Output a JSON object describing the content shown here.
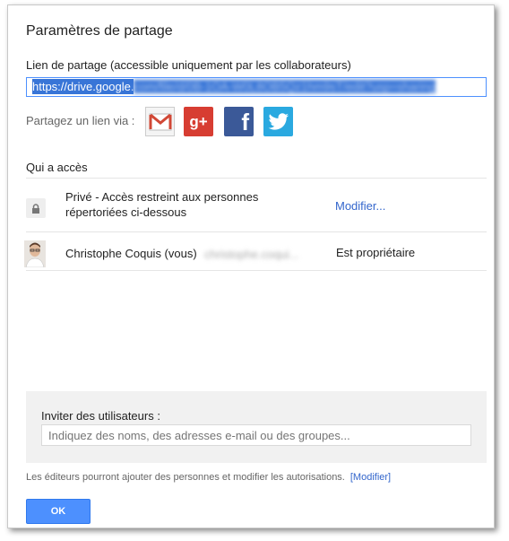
{
  "dialog": {
    "title": "Paramètres de partage"
  },
  "share_link": {
    "label": "Lien de partage (accessible uniquement par les collaborateurs)",
    "value_visible": "https://drive.google.",
    "value_blurred": "com/file/d/0B-1OA-W0L8OB5Qz1hm9sT/edit?usp=sharing"
  },
  "share_via": {
    "label": "Partagez un lien via :",
    "icons": [
      "gmail-icon",
      "google-plus-icon",
      "facebook-icon",
      "twitter-icon"
    ]
  },
  "access": {
    "label": "Qui a accès",
    "rows": [
      {
        "icon": "lock-icon",
        "line1": "Privé - Accès restreint aux personnes",
        "line2": "répertoriées ci-dessous",
        "action": "Modifier..."
      },
      {
        "icon": "avatar",
        "name": "Christophe Coquis (vous)",
        "email_blurred": "christophe.coqui...",
        "role": "Est propriétaire"
      }
    ]
  },
  "invite": {
    "label": "Inviter des utilisateurs :",
    "placeholder": "Indiquez des noms, des adresses e-mail ou des groupes..."
  },
  "footer": {
    "text": "Les éditeurs pourront ajouter des personnes et modifier les autorisations.",
    "link": "[Modifier]"
  },
  "ok_button": "OK",
  "colors": {
    "accent": "#4d90fe",
    "link": "#3366cc",
    "selection": "#3875d7"
  }
}
